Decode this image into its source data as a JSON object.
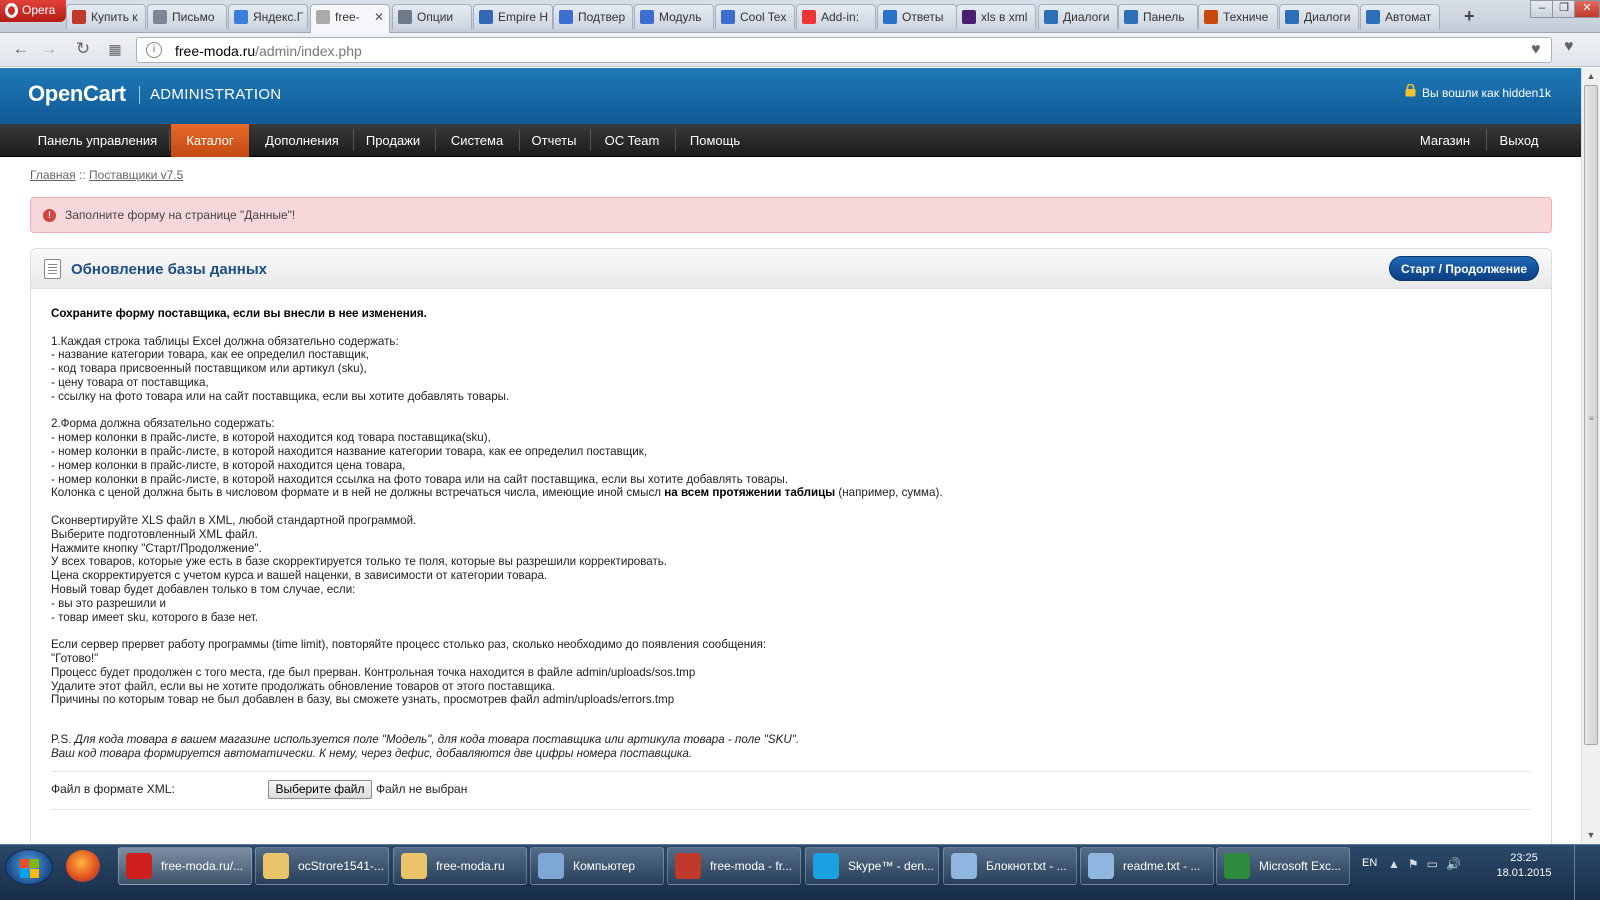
{
  "browser": {
    "opera_label": "Opera",
    "tabs": [
      {
        "label": "Купить к",
        "color": "#c0392b"
      },
      {
        "label": "Письмо",
        "color": "#7b8794"
      },
      {
        "label": "Яндекс.Г",
        "color": "#3b7dd8"
      },
      {
        "label": "free-",
        "color": "#aaa",
        "active": true
      },
      {
        "label": "Опции",
        "color": "#6c7a89"
      },
      {
        "label": "Empire H",
        "color": "#3567b8"
      },
      {
        "label": "Подтвер",
        "color": "#3b6ecf"
      },
      {
        "label": "Модуль",
        "color": "#3b6ecf"
      },
      {
        "label": "Cool Tex",
        "color": "#3b6ecf"
      },
      {
        "label": "Add-in:",
        "color": "#e33"
      },
      {
        "label": "Ответы",
        "color": "#2a73c9"
      },
      {
        "label": "xls в xml",
        "color": "#4a1d6e"
      },
      {
        "label": "Диалоги",
        "color": "#2a6fb8"
      },
      {
        "label": "Панель",
        "color": "#2a6fb8"
      },
      {
        "label": "Техниче",
        "color": "#c94b0c"
      },
      {
        "label": "Диалоги",
        "color": "#2a6fb8"
      },
      {
        "label": "Автомат",
        "color": "#2a6fb8"
      }
    ],
    "url_host": "free-moda.ru",
    "url_path": "/admin/index.php"
  },
  "header": {
    "logo": "OpenCart",
    "subtitle": "ADMINISTRATION",
    "login_text": "Вы вошли как hidden1k"
  },
  "menu": {
    "items": [
      "Панель управления",
      "Каталог",
      "Дополнения",
      "Продажи",
      "Система",
      "Отчеты",
      "OC Team",
      "Помощь"
    ],
    "right_items": [
      "Магазин",
      "Выход"
    ]
  },
  "breadcrumb": {
    "home": "Главная",
    "sep": "::",
    "current": "Поставщики v7.5"
  },
  "alert": {
    "text": "Заполните форму на странице \"Данные\"!"
  },
  "panel": {
    "title": "Обновление базы данных",
    "start_button": "Старт / Продолжение",
    "intro_bold": "Сохраните форму поставщика, если вы внесли в нее изменения.",
    "block1": [
      "1.Каждая строка таблицы Excel должна обязательно содержать:",
      "- название категории товара, как ее определил поставщик,",
      "- код товара присвоенный поставщиком или артикул (sku),",
      "- цену товара от поставщика,",
      "- ссылку на фото товара или на сайт поставщика, если вы хотите добавлять товары."
    ],
    "block2": [
      "2.Форма должна обязательно содержать:",
      "- номер колонки в прайс-листе, в которой находится код товара поставщика(sku),",
      "- номер колонки в прайс-листе, в которой находится название категории товара, как ее определил поставщик,",
      "- номер колонки в прайс-листе, в которой находится цена товара,",
      "- номер колонки в прайс-листе, в которой находится ссылка на фото товара или на сайт поставщика, если вы хотите добавлять товары."
    ],
    "price_note_a": "Колонка с ценой должна быть в числовом формате и в ней не должны встречаться числа, имеющие иной смысл ",
    "price_note_bold": "на всем протяжении таблицы",
    "price_note_b": " (например, сумма).",
    "block3": [
      "Сконвертируйте XLS файл в XML, любой стандартной программой.",
      "Выберите подготовленный XML файл.",
      "Нажмите кнопку \"Старт/Продолжение\".",
      "У всех товаров, которые уже есть в базе скорректируется только те поля, которые вы разрешили корректировать.",
      "Цена скорректируется с учетом курса и вашей наценки, в зависимости от категории товара.",
      "Новый товар будет добавлен только в том случае, если:",
      "- вы это разрешили и",
      "- товар имеет sku, которого в базе нет."
    ],
    "block4": [
      "Если сервер прервет работу программы (time limit), повторяйте процесс столько раз, сколько необходимо до появления сообщения:",
      "\"Готово!\"",
      "Процесс будет продолжен с того места, где был прерван. Контрольная точка находится в файле admin/uploads/sos.tmp",
      "Удалите этот файл, если вы не хотите продолжать обновление товаров от этого поставщика.",
      "Причины по которым товар не был добавлен в базу, вы сможете узнать, просмотрев файл admin/uploads/errors.tmp"
    ],
    "ps_prefix": "P.S. ",
    "ps_line1": "Для кода товара в вашем магазине используется поле \"Модель\", для кода товара поставщика или артикула товара - поле \"SKU\".",
    "ps_line2": "Ваш код товара формируется автоматически. К нему, через дефис, добавляются две цифры номера поставщика.",
    "file_label": "Файл в формате XML:",
    "file_button": "Выберите файл",
    "file_status": "Файл не выбран"
  },
  "taskbar": {
    "items": [
      {
        "label": "free-moda.ru/...",
        "color": "#d01f1f",
        "active": true
      },
      {
        "label": "ocStrore1541-...",
        "color": "#e9c46a"
      },
      {
        "label": "free-moda.ru",
        "color": "#e9c46a"
      },
      {
        "label": "Компьютер",
        "color": "#7fa7d6"
      },
      {
        "label": "free-moda - fr...",
        "color": "#c0392b"
      },
      {
        "label": "Skype™ - den...",
        "color": "#1ba1e2"
      },
      {
        "label": "Блокнот.txt - ...",
        "color": "#8fb7e0"
      },
      {
        "label": "readme.txt - ...",
        "color": "#8fb7e0"
      },
      {
        "label": "Microsoft Exc...",
        "color": "#2e8b3e"
      }
    ],
    "lang": "EN",
    "time": "23:25",
    "date": "18.01.2015"
  }
}
